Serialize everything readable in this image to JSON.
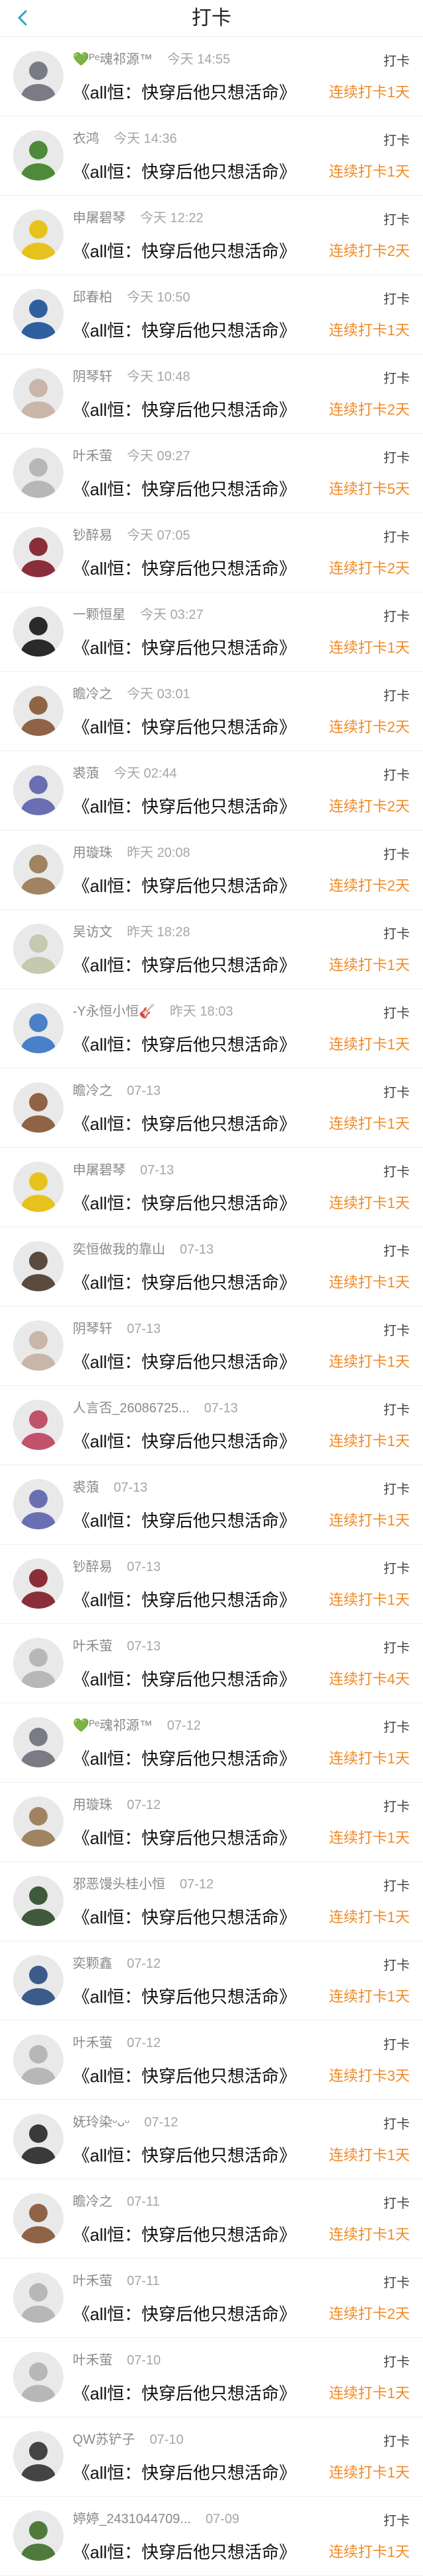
{
  "header": {
    "title": "打卡"
  },
  "entries": [
    {
      "name": "💚ᴾᵉ魂祁源™",
      "time": "今天 14:55",
      "book": "《all恒：快穿后他只想活命》",
      "tag": "打卡",
      "streak": "连续打卡1天",
      "avatar_color": "#7b7b85"
    },
    {
      "name": "衣鸿",
      "time": "今天 14:36",
      "book": "《all恒：快穿后他只想活命》",
      "tag": "打卡",
      "streak": "连续打卡1天",
      "avatar_color": "#4d8a3a"
    },
    {
      "name": "申屠碧琴",
      "time": "今天 12:22",
      "book": "《all恒：快穿后他只想活命》",
      "tag": "打卡",
      "streak": "连续打卡2天",
      "avatar_color": "#e8c21c"
    },
    {
      "name": "邱春柏",
      "time": "今天 10:50",
      "book": "《all恒：快穿后他只想活命》",
      "tag": "打卡",
      "streak": "连续打卡1天",
      "avatar_color": "#2f5f9e"
    },
    {
      "name": "阴琴轩",
      "time": "今天 10:48",
      "book": "《all恒：快穿后他只想活命》",
      "tag": "打卡",
      "streak": "连续打卡2天",
      "avatar_color": "#c9b6a8"
    },
    {
      "name": "叶禾萤",
      "time": "今天 09:27",
      "book": "《all恒：快穿后他只想活命》",
      "tag": "打卡",
      "streak": "连续打卡5天",
      "avatar_color": "#b7b7b7"
    },
    {
      "name": "钞醉易",
      "time": "今天 07:05",
      "book": "《all恒：快穿后他只想活命》",
      "tag": "打卡",
      "streak": "连续打卡2天",
      "avatar_color": "#8a2f3a"
    },
    {
      "name": "一颗恒星",
      "time": "今天 03:27",
      "book": "《all恒：快穿后他只想活命》",
      "tag": "打卡",
      "streak": "连续打卡1天",
      "avatar_color": "#2a2a2a"
    },
    {
      "name": "瞻冷之",
      "time": "今天 03:01",
      "book": "《all恒：快穿后他只想活命》",
      "tag": "打卡",
      "streak": "连续打卡2天",
      "avatar_color": "#8f6446"
    },
    {
      "name": "裘蒗",
      "time": "今天 02:44",
      "book": "《all恒：快穿后他只想活命》",
      "tag": "打卡",
      "streak": "连续打卡2天",
      "avatar_color": "#6a6fb3"
    },
    {
      "name": "用璇珠",
      "time": "昨天 20:08",
      "book": "《all恒：快穿后他只想活命》",
      "tag": "打卡",
      "streak": "连续打卡2天",
      "avatar_color": "#a08360"
    },
    {
      "name": "吴访文",
      "time": "昨天 18:28",
      "book": "《all恒：快穿后他只想活命》",
      "tag": "打卡",
      "streak": "连续打卡1天",
      "avatar_color": "#c6c9b0"
    },
    {
      "name": "-Y永恒小恒🎸",
      "time": "昨天 18:03",
      "book": "《all恒：快穿后他只想活命》",
      "tag": "打卡",
      "streak": "连续打卡1天",
      "avatar_color": "#4a7fc9"
    },
    {
      "name": "瞻冷之",
      "time": "07-13",
      "book": "《all恒：快穿后他只想活命》",
      "tag": "打卡",
      "streak": "连续打卡1天",
      "avatar_color": "#8f6446"
    },
    {
      "name": "申屠碧琴",
      "time": "07-13",
      "book": "《all恒：快穿后他只想活命》",
      "tag": "打卡",
      "streak": "连续打卡1天",
      "avatar_color": "#e8c21c"
    },
    {
      "name": "奕恒做我的靠山",
      "time": "07-13",
      "book": "《all恒：快穿后他只想活命》",
      "tag": "打卡",
      "streak": "连续打卡1天",
      "avatar_color": "#5b4a3e"
    },
    {
      "name": "阴琴轩",
      "time": "07-13",
      "book": "《all恒：快穿后他只想活命》",
      "tag": "打卡",
      "streak": "连续打卡1天",
      "avatar_color": "#c9b6a8"
    },
    {
      "name": "人言否_26086725...",
      "time": "07-13",
      "book": "《all恒：快穿后他只想活命》",
      "tag": "打卡",
      "streak": "连续打卡1天",
      "avatar_color": "#c2526a"
    },
    {
      "name": "裘蒗",
      "time": "07-13",
      "book": "《all恒：快穿后他只想活命》",
      "tag": "打卡",
      "streak": "连续打卡1天",
      "avatar_color": "#6a6fb3"
    },
    {
      "name": "钞醉易",
      "time": "07-13",
      "book": "《all恒：快穿后他只想活命》",
      "tag": "打卡",
      "streak": "连续打卡1天",
      "avatar_color": "#8a2f3a"
    },
    {
      "name": "叶禾萤",
      "time": "07-13",
      "book": "《all恒：快穿后他只想活命》",
      "tag": "打卡",
      "streak": "连续打卡4天",
      "avatar_color": "#b7b7b7"
    },
    {
      "name": "💚ᴾᵉ魂祁源™",
      "time": "07-12",
      "book": "《all恒：快穿后他只想活命》",
      "tag": "打卡",
      "streak": "连续打卡1天",
      "avatar_color": "#7b7b85"
    },
    {
      "name": "用璇珠",
      "time": "07-12",
      "book": "《all恒：快穿后他只想活命》",
      "tag": "打卡",
      "streak": "连续打卡1天",
      "avatar_color": "#a08360"
    },
    {
      "name": "邪恶馒头桂小恒",
      "time": "07-12",
      "book": "《all恒：快穿后他只想活命》",
      "tag": "打卡",
      "streak": "连续打卡1天",
      "avatar_color": "#3f5a3a"
    },
    {
      "name": "奕颗鑫",
      "time": "07-12",
      "book": "《all恒：快穿后他只想活命》",
      "tag": "打卡",
      "streak": "连续打卡1天",
      "avatar_color": "#3b5b8a"
    },
    {
      "name": "叶禾萤",
      "time": "07-12",
      "book": "《all恒：快穿后他只想活命》",
      "tag": "打卡",
      "streak": "连续打卡3天",
      "avatar_color": "#b7b7b7"
    },
    {
      "name": "妩玲染ᵕᴗᵕ",
      "time": "07-12",
      "book": "《all恒：快穿后他只想活命》",
      "tag": "打卡",
      "streak": "连续打卡1天",
      "avatar_color": "#3a3a3a"
    },
    {
      "name": "瞻冷之",
      "time": "07-11",
      "book": "《all恒：快穿后他只想活命》",
      "tag": "打卡",
      "streak": "连续打卡1天",
      "avatar_color": "#8f6446"
    },
    {
      "name": "叶禾萤",
      "time": "07-11",
      "book": "《all恒：快穿后他只想活命》",
      "tag": "打卡",
      "streak": "连续打卡2天",
      "avatar_color": "#b7b7b7"
    },
    {
      "name": "叶禾萤",
      "time": "07-10",
      "book": "《all恒：快穿后他只想活命》",
      "tag": "打卡",
      "streak": "连续打卡1天",
      "avatar_color": "#b7b7b7"
    },
    {
      "name": "QW苏铲子",
      "time": "07-10",
      "book": "《all恒：快穿后他只想活命》",
      "tag": "打卡",
      "streak": "连续打卡1天",
      "avatar_color": "#444444"
    },
    {
      "name": "婷婷_2431044709...",
      "time": "07-09",
      "book": "《all恒：快穿后他只想活命》",
      "tag": "打卡",
      "streak": "连续打卡1天",
      "avatar_color": "#4f7a3c"
    }
  ]
}
